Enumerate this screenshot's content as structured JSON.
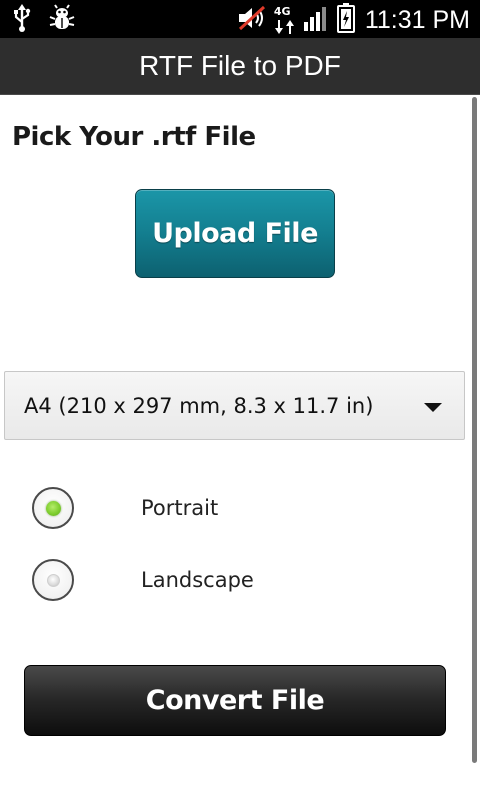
{
  "status_bar": {
    "time": "11:31 PM",
    "network_label": "4G",
    "icons": [
      "usb-icon",
      "debug-bug-icon",
      "muted-speaker-icon",
      "network-4g-icon",
      "signal-bars-icon",
      "battery-charging-icon"
    ]
  },
  "app": {
    "title": "RTF File to PDF"
  },
  "main": {
    "pick_label": "Pick Your .rtf File",
    "upload_label": "Upload File",
    "paper_size": {
      "selected": "A4 (210 x 297 mm, 8.3 x 11.7 in)"
    },
    "orientation": {
      "options": [
        {
          "label": "Portrait",
          "selected": true
        },
        {
          "label": "Landscape",
          "selected": false
        }
      ]
    },
    "convert_label": "Convert File"
  },
  "colors": {
    "upload_button": "#137e8f",
    "radio_selected": "#7fce2f",
    "title_bar": "#2e2e2e",
    "convert_button": "#1a1a1a"
  }
}
